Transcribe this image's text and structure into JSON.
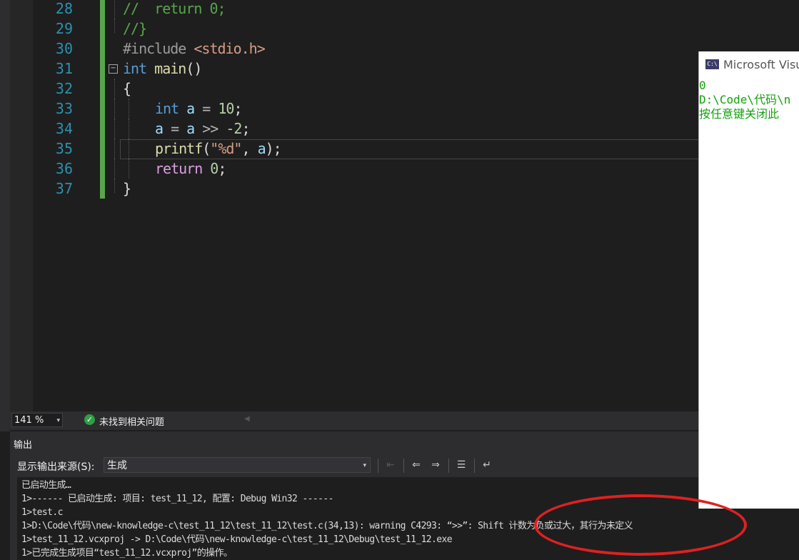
{
  "editor": {
    "lines": [
      28,
      29,
      30,
      31,
      32,
      33,
      34,
      35,
      36,
      37
    ],
    "code": {
      "l28_comment": "//  return 0;",
      "l29_comment": "//}",
      "l30_directive": "#include",
      "l30_header": "<stdio.h>",
      "l31_type": "int",
      "l31_name": "main",
      "l31_parens": "()",
      "l32": "{",
      "l33_type": "int",
      "l33_var": "a",
      "l33_op": " = ",
      "l33_num": "10",
      "l33_end": ";",
      "l34_var1": "a",
      "l34_op1": " = ",
      "l34_var2": "a",
      "l34_op2": " >> ",
      "l34_num": "-2",
      "l34_end": ";",
      "l35_fn": "printf",
      "l35_open": "(",
      "l35_str": "\"%d\"",
      "l35_comma": ", ",
      "l35_var": "a",
      "l35_close": ");",
      "l36_kw": "return",
      "l36_num": " 0",
      "l36_end": ";",
      "l37": "}"
    },
    "collapse_glyph": "−"
  },
  "status": {
    "zoom": "141 %",
    "issues_text": "未找到相关问题",
    "dropdown_glyph": "▾",
    "scroll_glyph": "◀"
  },
  "output": {
    "title": "输出",
    "source_label": "显示输出来源(S):",
    "source_value": "生成",
    "lines": [
      "已启动生成…",
      "1>------ 已启动生成: 项目: test_11_12, 配置: Debug Win32 ------",
      "1>test.c",
      "1>D:\\Code\\代码\\new-knowledge-c\\test_11_12\\test_11_12\\test.c(34,13): warning C4293: “>>”: Shift 计数为负或过大，其行为未定义",
      "1>test_11_12.vcxproj -> D:\\Code\\代码\\new-knowledge-c\\test_11_12\\Debug\\test_11_12.exe",
      "1>已完成生成项目“test_11_12.vcxproj”的操作。"
    ]
  },
  "console": {
    "title": "Microsoft Visual",
    "icon_label": "C:\\",
    "lines": [
      "0",
      "D:\\Code\\代码\\n",
      "按任意键关闭此"
    ]
  },
  "colors": {
    "keyword": "#569cd6",
    "comment": "#57a64a",
    "string": "#d69d85",
    "number": "#b5cea8",
    "function": "#dcdcaa",
    "console_text": "#13a10e",
    "annotation": "#e02020"
  }
}
